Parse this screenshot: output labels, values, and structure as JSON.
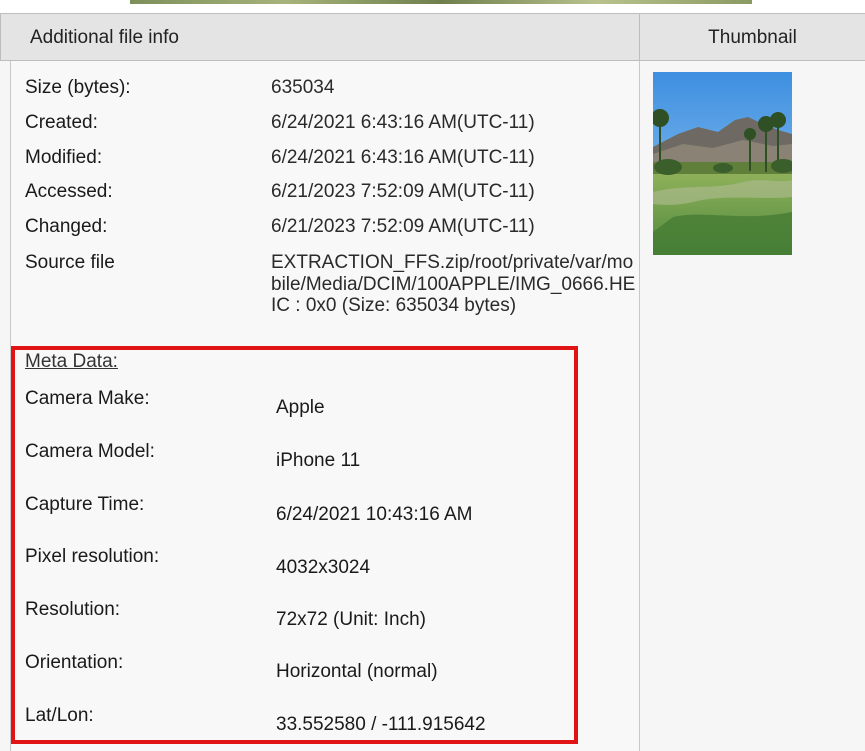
{
  "header": {
    "left_title": "Additional file info",
    "right_title": "Thumbnail"
  },
  "file_info": [
    {
      "label": "Size (bytes):",
      "value": "635034"
    },
    {
      "label": "Created:",
      "value": "6/24/2021 6:43:16 AM(UTC-11)"
    },
    {
      "label": "Modified:",
      "value": "6/24/2021 6:43:16 AM(UTC-11)"
    },
    {
      "label": "Accessed:",
      "value": "6/21/2023 7:52:09 AM(UTC-11)"
    },
    {
      "label": "Changed:",
      "value": "6/21/2023 7:52:09 AM(UTC-11)"
    }
  ],
  "source_file": {
    "label": "Source file",
    "value": "EXTRACTION_FFS.zip/root/private/var/mobile/Media/DCIM/100APPLE/IMG_0666.HEIC : 0x0 (Size: 635034 bytes)"
  },
  "meta": {
    "heading": "Meta Data:",
    "items": [
      {
        "label": "Camera Make:",
        "value": "Apple"
      },
      {
        "label": "Camera Model:",
        "value": "iPhone 11"
      },
      {
        "label": "Capture Time:",
        "value": "6/24/2021 10:43:16 AM"
      },
      {
        "label": "Pixel resolution:",
        "value": "4032x3024"
      },
      {
        "label": "Resolution:",
        "value": "72x72 (Unit: Inch)"
      },
      {
        "label": "Orientation:",
        "value": "Horizontal (normal)"
      },
      {
        "label": "Lat/Lon:",
        "value": "33.552580 / -111.915642"
      }
    ]
  },
  "colors": {
    "highlight_border": "#e01414",
    "header_bg": "#e4e4e4"
  }
}
